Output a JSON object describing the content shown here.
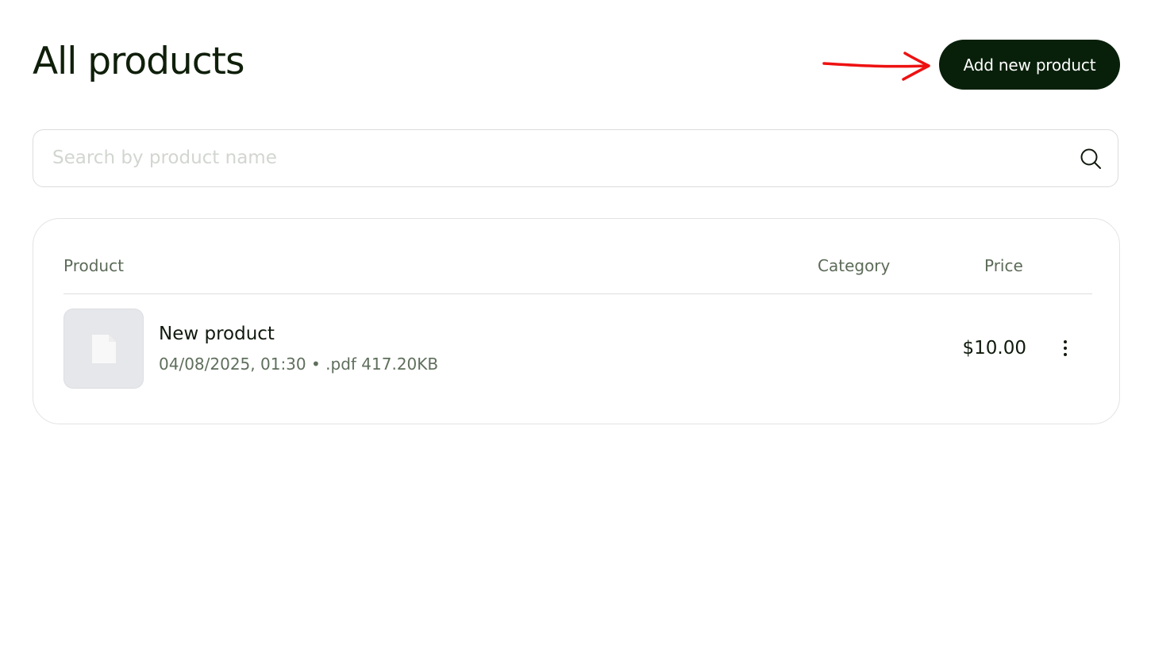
{
  "header": {
    "title": "All products",
    "add_button_label": "Add new product"
  },
  "search": {
    "placeholder": "Search by product name",
    "value": "",
    "icon": "search-icon"
  },
  "table": {
    "columns": {
      "product": "Product",
      "category": "Category",
      "price": "Price"
    },
    "rows": [
      {
        "name": "New product",
        "date": "04/08/2025, 01:30",
        "separator": "•",
        "file_type": ".pdf",
        "file_size": "417.20KB",
        "meta": "04/08/2025, 01:30 • .pdf 417.20KB",
        "category": "",
        "price": "$10.00",
        "thumbnail_icon": "file-icon",
        "menu_icon": "more-vertical-icon"
      }
    ]
  },
  "annotation": {
    "icon": "red-arrow-icon",
    "color": "#ee1111"
  },
  "colors": {
    "button_bg": "#08200a",
    "title": "#0f1f0a",
    "muted_text": "#5f6f5c"
  }
}
